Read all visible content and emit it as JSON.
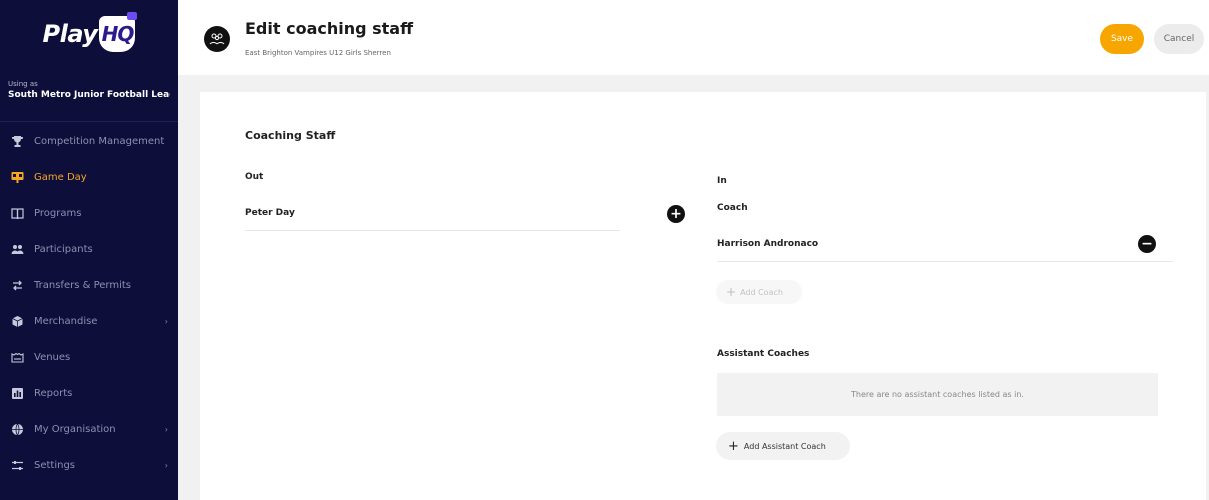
{
  "brand": {
    "logo_play": "Play",
    "logo_hq": "HQ"
  },
  "org": {
    "using_as": "Using as",
    "name": "South Metro Junior Football Leagu"
  },
  "sidebar": {
    "items": [
      {
        "label": "Competition Management",
        "icon": "trophy-icon"
      },
      {
        "label": "Game Day",
        "icon": "scoreboard-icon",
        "active": true
      },
      {
        "label": "Programs",
        "icon": "book-icon"
      },
      {
        "label": "Participants",
        "icon": "people-icon"
      },
      {
        "label": "Transfers & Permits",
        "icon": "transfer-arrows-icon"
      },
      {
        "label": "Merchandise",
        "icon": "merchandise-icon",
        "has_submenu": true
      },
      {
        "label": "Venues",
        "icon": "stadium-icon"
      },
      {
        "label": "Reports",
        "icon": "chart-icon"
      },
      {
        "label": "My Organisation",
        "icon": "globe-icon",
        "has_submenu": true
      },
      {
        "label": "Settings",
        "icon": "sliders-icon",
        "has_submenu": true
      }
    ]
  },
  "header": {
    "title": "Edit coaching staff",
    "subtitle": "East Brighton Vampires U12 Girls Sherren",
    "save_label": "Save",
    "cancel_label": "Cancel"
  },
  "staff": {
    "section_title": "Coaching Staff",
    "out_label": "Out",
    "out_people": [
      "Peter Day"
    ],
    "in_label": "In",
    "coach_label": "Coach",
    "coaches": [
      "Harrison Andronaco"
    ],
    "add_coach_label": "Add Coach",
    "assistant_label": "Assistant Coaches",
    "assistant_empty": "There are no assistant coaches listed as in.",
    "add_assistant_label": "Add Assistant Coach"
  },
  "colors": {
    "sidebar_bg": "#0d0e3a",
    "accent": "#f7a600",
    "active_nav": "#f5a623"
  }
}
